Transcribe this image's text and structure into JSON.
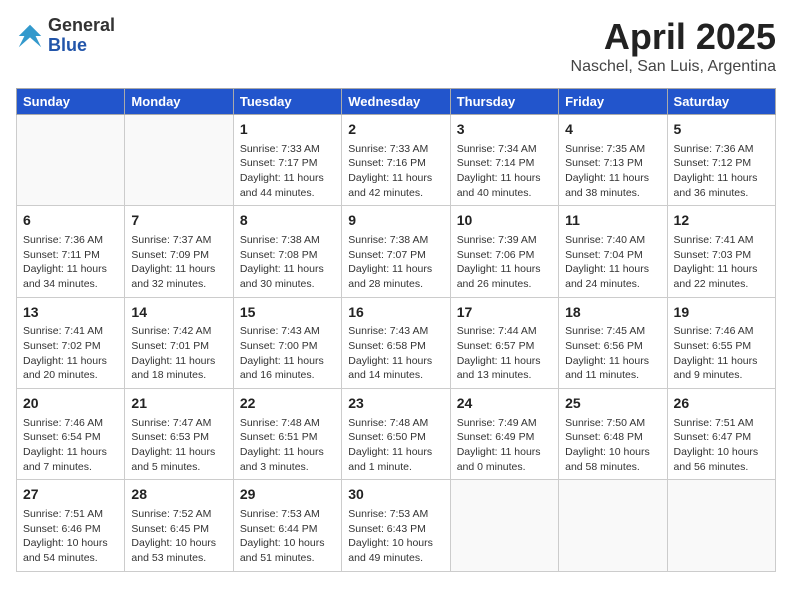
{
  "header": {
    "logo_general": "General",
    "logo_blue": "Blue",
    "month_title": "April 2025",
    "subtitle": "Naschel, San Luis, Argentina"
  },
  "weekdays": [
    "Sunday",
    "Monday",
    "Tuesday",
    "Wednesday",
    "Thursday",
    "Friday",
    "Saturday"
  ],
  "weeks": [
    [
      {
        "day": "",
        "info": ""
      },
      {
        "day": "",
        "info": ""
      },
      {
        "day": "1",
        "info": "Sunrise: 7:33 AM\nSunset: 7:17 PM\nDaylight: 11 hours and 44 minutes."
      },
      {
        "day": "2",
        "info": "Sunrise: 7:33 AM\nSunset: 7:16 PM\nDaylight: 11 hours and 42 minutes."
      },
      {
        "day": "3",
        "info": "Sunrise: 7:34 AM\nSunset: 7:14 PM\nDaylight: 11 hours and 40 minutes."
      },
      {
        "day": "4",
        "info": "Sunrise: 7:35 AM\nSunset: 7:13 PM\nDaylight: 11 hours and 38 minutes."
      },
      {
        "day": "5",
        "info": "Sunrise: 7:36 AM\nSunset: 7:12 PM\nDaylight: 11 hours and 36 minutes."
      }
    ],
    [
      {
        "day": "6",
        "info": "Sunrise: 7:36 AM\nSunset: 7:11 PM\nDaylight: 11 hours and 34 minutes."
      },
      {
        "day": "7",
        "info": "Sunrise: 7:37 AM\nSunset: 7:09 PM\nDaylight: 11 hours and 32 minutes."
      },
      {
        "day": "8",
        "info": "Sunrise: 7:38 AM\nSunset: 7:08 PM\nDaylight: 11 hours and 30 minutes."
      },
      {
        "day": "9",
        "info": "Sunrise: 7:38 AM\nSunset: 7:07 PM\nDaylight: 11 hours and 28 minutes."
      },
      {
        "day": "10",
        "info": "Sunrise: 7:39 AM\nSunset: 7:06 PM\nDaylight: 11 hours and 26 minutes."
      },
      {
        "day": "11",
        "info": "Sunrise: 7:40 AM\nSunset: 7:04 PM\nDaylight: 11 hours and 24 minutes."
      },
      {
        "day": "12",
        "info": "Sunrise: 7:41 AM\nSunset: 7:03 PM\nDaylight: 11 hours and 22 minutes."
      }
    ],
    [
      {
        "day": "13",
        "info": "Sunrise: 7:41 AM\nSunset: 7:02 PM\nDaylight: 11 hours and 20 minutes."
      },
      {
        "day": "14",
        "info": "Sunrise: 7:42 AM\nSunset: 7:01 PM\nDaylight: 11 hours and 18 minutes."
      },
      {
        "day": "15",
        "info": "Sunrise: 7:43 AM\nSunset: 7:00 PM\nDaylight: 11 hours and 16 minutes."
      },
      {
        "day": "16",
        "info": "Sunrise: 7:43 AM\nSunset: 6:58 PM\nDaylight: 11 hours and 14 minutes."
      },
      {
        "day": "17",
        "info": "Sunrise: 7:44 AM\nSunset: 6:57 PM\nDaylight: 11 hours and 13 minutes."
      },
      {
        "day": "18",
        "info": "Sunrise: 7:45 AM\nSunset: 6:56 PM\nDaylight: 11 hours and 11 minutes."
      },
      {
        "day": "19",
        "info": "Sunrise: 7:46 AM\nSunset: 6:55 PM\nDaylight: 11 hours and 9 minutes."
      }
    ],
    [
      {
        "day": "20",
        "info": "Sunrise: 7:46 AM\nSunset: 6:54 PM\nDaylight: 11 hours and 7 minutes."
      },
      {
        "day": "21",
        "info": "Sunrise: 7:47 AM\nSunset: 6:53 PM\nDaylight: 11 hours and 5 minutes."
      },
      {
        "day": "22",
        "info": "Sunrise: 7:48 AM\nSunset: 6:51 PM\nDaylight: 11 hours and 3 minutes."
      },
      {
        "day": "23",
        "info": "Sunrise: 7:48 AM\nSunset: 6:50 PM\nDaylight: 11 hours and 1 minute."
      },
      {
        "day": "24",
        "info": "Sunrise: 7:49 AM\nSunset: 6:49 PM\nDaylight: 11 hours and 0 minutes."
      },
      {
        "day": "25",
        "info": "Sunrise: 7:50 AM\nSunset: 6:48 PM\nDaylight: 10 hours and 58 minutes."
      },
      {
        "day": "26",
        "info": "Sunrise: 7:51 AM\nSunset: 6:47 PM\nDaylight: 10 hours and 56 minutes."
      }
    ],
    [
      {
        "day": "27",
        "info": "Sunrise: 7:51 AM\nSunset: 6:46 PM\nDaylight: 10 hours and 54 minutes."
      },
      {
        "day": "28",
        "info": "Sunrise: 7:52 AM\nSunset: 6:45 PM\nDaylight: 10 hours and 53 minutes."
      },
      {
        "day": "29",
        "info": "Sunrise: 7:53 AM\nSunset: 6:44 PM\nDaylight: 10 hours and 51 minutes."
      },
      {
        "day": "30",
        "info": "Sunrise: 7:53 AM\nSunset: 6:43 PM\nDaylight: 10 hours and 49 minutes."
      },
      {
        "day": "",
        "info": ""
      },
      {
        "day": "",
        "info": ""
      },
      {
        "day": "",
        "info": ""
      }
    ]
  ]
}
